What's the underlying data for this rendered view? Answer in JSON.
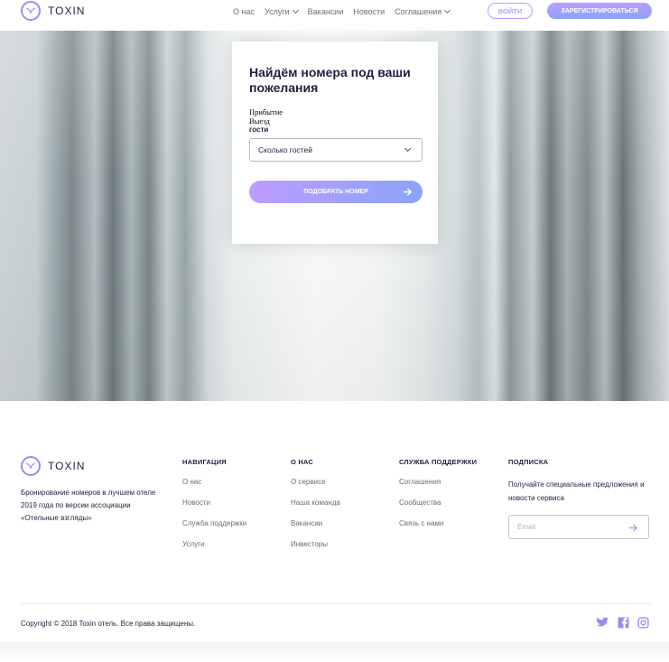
{
  "header": {
    "brand": "TOXIN",
    "nav": [
      {
        "label": "О нас",
        "dropdown": false
      },
      {
        "label": "Услуги",
        "dropdown": true
      },
      {
        "label": "Вакансии",
        "dropdown": false
      },
      {
        "label": "Новости",
        "dropdown": false
      },
      {
        "label": "Соглашения",
        "dropdown": true
      }
    ],
    "login_label": "ВОЙТИ",
    "register_label": "ЗАРЕГИСТРИРОВАТЬСЯ"
  },
  "search_card": {
    "title": "Найдём номера под ваши пожелания",
    "arrival_label": "Прибытие",
    "departure_label": "Выезд",
    "guests_label": "гости",
    "guests_placeholder": "Сколько гостей",
    "submit_label": "ПОДОБРАТЬ НОМЕР"
  },
  "footer": {
    "brand": "TOXIN",
    "description": "Бронирование номеров в лучшем отеле 2019 года по версии ассоциации «Отельные взгляды»",
    "columns": [
      {
        "title": "НАВИГАЦИЯ",
        "links": [
          "О нас",
          "Новости",
          "Служба поддержки",
          "Услуги"
        ]
      },
      {
        "title": "О НАС",
        "links": [
          "О сервисе",
          "Наша команда",
          "Вакансии",
          "Инвесторы"
        ]
      },
      {
        "title": "СЛУЖБА ПОДДЕРЖКИ",
        "links": [
          "Соглашения",
          "Сообщества",
          "Связь с нами"
        ]
      }
    ],
    "subscribe": {
      "title": "ПОДПИСКА",
      "description": "Получайте специальные предложения и новости сервиса",
      "email_placeholder": "Email"
    },
    "copyright": "Copyright © 2018 Toxin отель. Все права защищены.",
    "socials": [
      "twitter-icon",
      "facebook-icon",
      "instagram-icon"
    ]
  },
  "colors": {
    "accent": "#bc9cff",
    "accent2": "#8ba4f9",
    "dark": "#1f2041"
  }
}
